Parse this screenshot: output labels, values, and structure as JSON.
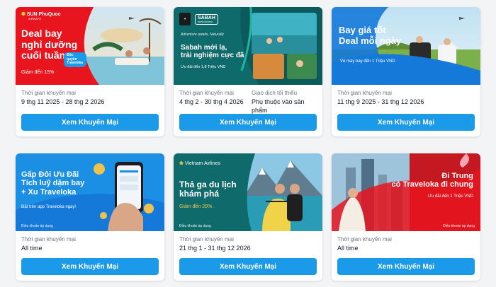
{
  "cards": [
    {
      "banner": {
        "brand": "SUN PhuQuoc",
        "brand_sub": "AIRWAYS",
        "title_line1": "Deal bay",
        "title_line2": "nghỉ dưỡng",
        "title_line3": "cuối tuần",
        "pill": "Độc quyền Traveloka",
        "sub": "Giảm đến 15%"
      },
      "meta": [
        {
          "label": "Thời gian khuyến mại",
          "value": "9 thg 11 2025 - 28 thg 2 2026"
        }
      ],
      "cta": "Xem Khuyến Mại"
    },
    {
      "banner": {
        "brand": "SABAH",
        "brand_sub": "North Borneo",
        "tagline": "Adventure awaits, Naturally",
        "title_line1": "Sabah mới lạ,",
        "title_line2": "trải nghiệm cực đã",
        "sub": "Ưu đãi đến 1,8 Triệu VND"
      },
      "meta": [
        {
          "label": "Thời gian khuyến mại",
          "value": "4 thg 2 - 30 thg 4 2026"
        },
        {
          "label": "Giao dịch tối thiểu",
          "value": "Phụ thuộc vào sản phẩm"
        }
      ],
      "cta": "Xem Khuyến Mại"
    },
    {
      "banner": {
        "title_line1": "Bay giá tốt",
        "title_line2": "Deal mỗi ngày",
        "sub": "Vé máy bay đến 1 Triệu VND"
      },
      "meta": [
        {
          "label": "Thời gian khuyến mại",
          "value": "11 thg 9 2025 - 31 thg 12 2026"
        }
      ],
      "cta": "Xem Khuyến Mại"
    },
    {
      "banner": {
        "title_line1": "Gấp Đôi Ưu Đãi",
        "title_line2": "Tích luỹ dặm bay",
        "title_line3": "+ Xu Traveloka",
        "sub": "Đặt trên app Traveloka ngay!",
        "terms": "Điều khoản áp dụng"
      },
      "meta": [
        {
          "label": "Thời gian khuyến mại",
          "value": "All time"
        }
      ],
      "cta": "Xem Khuyến Mại"
    },
    {
      "banner": {
        "brand": "Vietnam Airlines",
        "title_line1": "Thả ga du lịch",
        "title_line2": "khám phá",
        "sub": "Giảm đến 29%",
        "terms": "Điều khoản áp dụng"
      },
      "meta": [
        {
          "label": "Thời gian khuyến mại",
          "value": "21 thg 1 - 31 thg 12 2026"
        }
      ],
      "cta": "Xem Khuyến Mại"
    },
    {
      "banner": {
        "title_line1": "Đi Trung",
        "title_line2": "có Traveloka đi chung",
        "sub": "Ưu đãi đến 1 Triệu VND",
        "terms": "Điều khoản áp dụng"
      },
      "meta": [
        {
          "label": "Thời gian khuyến mại",
          "value": "All time"
        }
      ],
      "cta": "Xem Khuyến Mại"
    }
  ],
  "colors": {
    "cta": "#1a9ae8",
    "red": "#e8141e",
    "teal": "#0f6b6b",
    "blue": "#1479d9"
  }
}
